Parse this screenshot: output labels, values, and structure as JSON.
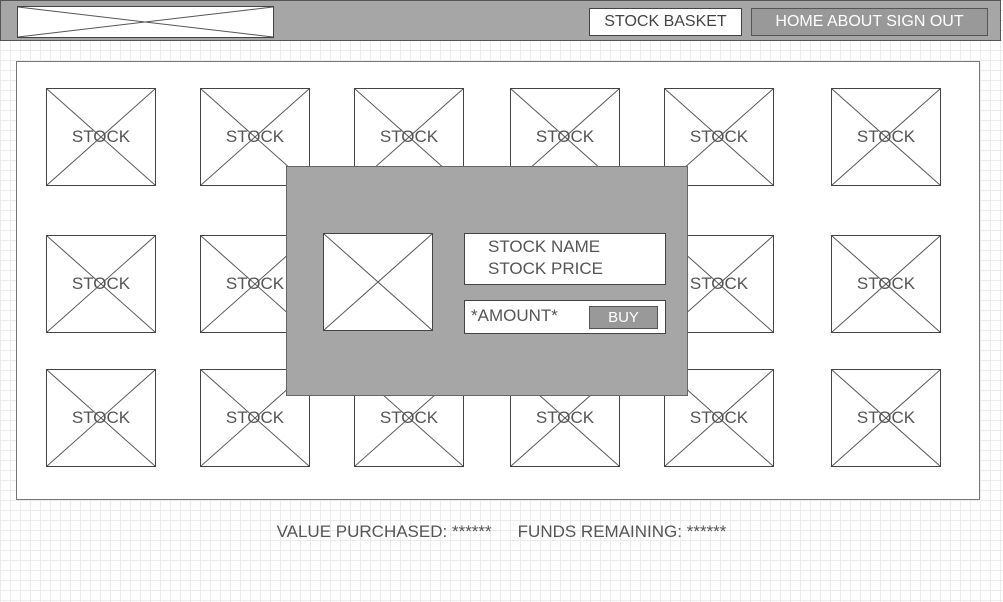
{
  "header": {
    "logo_icon": "image-placeholder-icon",
    "basket_label": "STOCK BASKET",
    "nav": [
      "HOME",
      "ABOUT",
      "SIGN OUT"
    ]
  },
  "grid": {
    "stock_label": "STOCK",
    "rows": 3,
    "columns": 6
  },
  "modal": {
    "image_icon": "image-placeholder-icon",
    "stock_name": "STOCK NAME",
    "stock_price": "STOCK PRICE",
    "amount_placeholder": "*AMOUNT*",
    "buy_label": "BUY"
  },
  "footer": {
    "value_purchased": "VALUE PURCHASED: ******",
    "funds_remaining": "FUNDS REMAINING: ******"
  },
  "colors": {
    "bar": "#a6a6a6",
    "nav": "#999999",
    "grid": "#ececec"
  }
}
